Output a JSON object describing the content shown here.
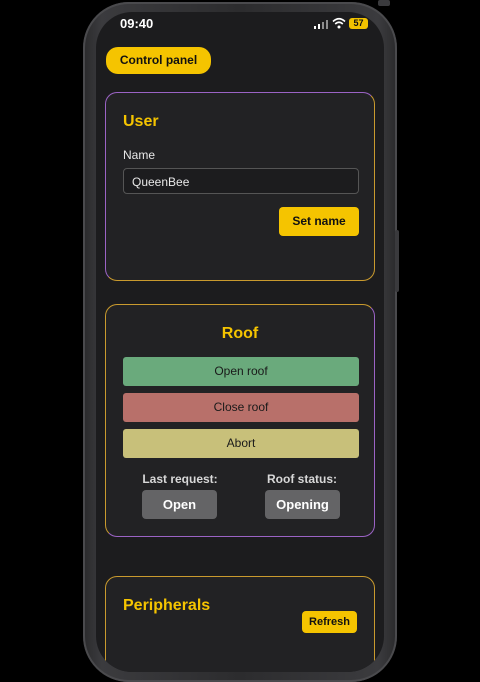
{
  "status": {
    "time": "09:40",
    "battery": "57"
  },
  "header": {
    "chip_label": "Control panel"
  },
  "user_card": {
    "title": "User",
    "name_label": "Name",
    "name_value": "QueenBee",
    "set_button": "Set name"
  },
  "roof_card": {
    "title": "Roof",
    "open_button": "Open roof",
    "close_button": "Close roof",
    "abort_button": "Abort",
    "last_request_label": "Last request:",
    "last_request_value": "Open",
    "roof_status_label": "Roof status:",
    "roof_status_value": "Opening"
  },
  "peripherals_card": {
    "title": "Peripherals",
    "refresh_button": "Refresh"
  },
  "colors": {
    "accent": "#f5c400",
    "open": "#6aaa7c",
    "close": "#b8706a",
    "abort": "#c8c07a"
  }
}
